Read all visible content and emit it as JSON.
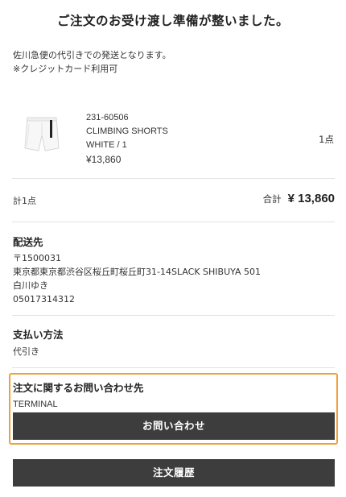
{
  "page": {
    "title": "ご注文のお受け渡し準備が整いました。"
  },
  "shipping_note": {
    "line1": "佐川急便の代引きでの発送となります。",
    "line2": "※クレジットカード利用可"
  },
  "order_item": {
    "image_icon": "white-shorts-product-image",
    "product_code": "231-60506",
    "product_name": "CLIMBING SHORTS",
    "variant": "WHITE / 1",
    "price": "¥13,860",
    "quantity": "1点"
  },
  "summary": {
    "item_count": "計1点",
    "total_label": "合計",
    "total_amount": "¥ 13,860"
  },
  "delivery": {
    "heading": "配送先",
    "postal_code": "〒1500031",
    "address": "東京都東京都渋谷区桜丘町桜丘町31-14SLACK SHIBUYA 501",
    "name": "白川ゆき",
    "phone": "05017314312"
  },
  "payment": {
    "heading": "支払い方法",
    "method": "代引き"
  },
  "inquiry": {
    "heading": "注文に関するお問い合わせ先",
    "company": "TERMINAL",
    "button_label": "お問い合わせ",
    "highlight_color": "#f0a035"
  },
  "footer": {
    "order_history_label": "注文履歴"
  },
  "colors": {
    "button_bg": "#3d3d3d",
    "divider": "#e2e2e2"
  }
}
